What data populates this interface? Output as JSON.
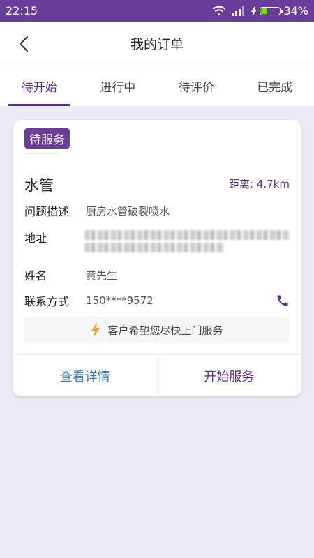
{
  "status_bar": {
    "time": "22:15",
    "battery": "34%"
  },
  "header": {
    "title": "我的订单"
  },
  "tabs": [
    {
      "label": "待开始",
      "active": true
    },
    {
      "label": "进行中",
      "active": false
    },
    {
      "label": "待评价",
      "active": false
    },
    {
      "label": "已完成",
      "active": false
    }
  ],
  "order": {
    "status": "待服务",
    "service_type": "水管",
    "distance": "距离: 4.7km",
    "fields": {
      "desc_label": "问题描述",
      "desc_value": "厨房水管破裂喷水",
      "addr_label": "地址",
      "name_label": "姓名",
      "name_value": "黄先生",
      "contact_label": "联系方式",
      "contact_value": "150****9572"
    },
    "notice": "客户希望您尽快上门服务",
    "actions": {
      "detail": "查看详情",
      "start": "开始服务"
    }
  },
  "colors": {
    "primary": "#6a3d9a",
    "link": "#3e7ab8",
    "warning": "#f5a623"
  }
}
